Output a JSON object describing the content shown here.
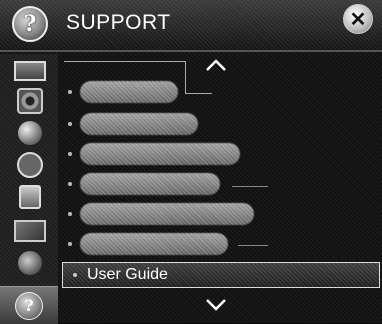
{
  "header": {
    "title": "SUPPORT",
    "help_icon_glyph": "?",
    "close_glyph": "✕"
  },
  "sidebar": {
    "items": [
      {
        "icon": "picture-icon"
      },
      {
        "icon": "audio-icon"
      },
      {
        "icon": "network-icon"
      },
      {
        "icon": "timer-icon"
      },
      {
        "icon": "lock-icon"
      },
      {
        "icon": "input-icon"
      },
      {
        "icon": "system-icon"
      },
      {
        "icon": "help-icon",
        "glyph": "?",
        "active": true
      }
    ]
  },
  "menu": {
    "items": [
      {
        "label": ""
      },
      {
        "label": ""
      },
      {
        "label": ""
      },
      {
        "label": ""
      },
      {
        "label": ""
      },
      {
        "label": ""
      }
    ],
    "selected_label": "User Guide"
  },
  "colors": {
    "background": "#111111",
    "text": "#ffffff",
    "focus_border": "#dddddd"
  }
}
